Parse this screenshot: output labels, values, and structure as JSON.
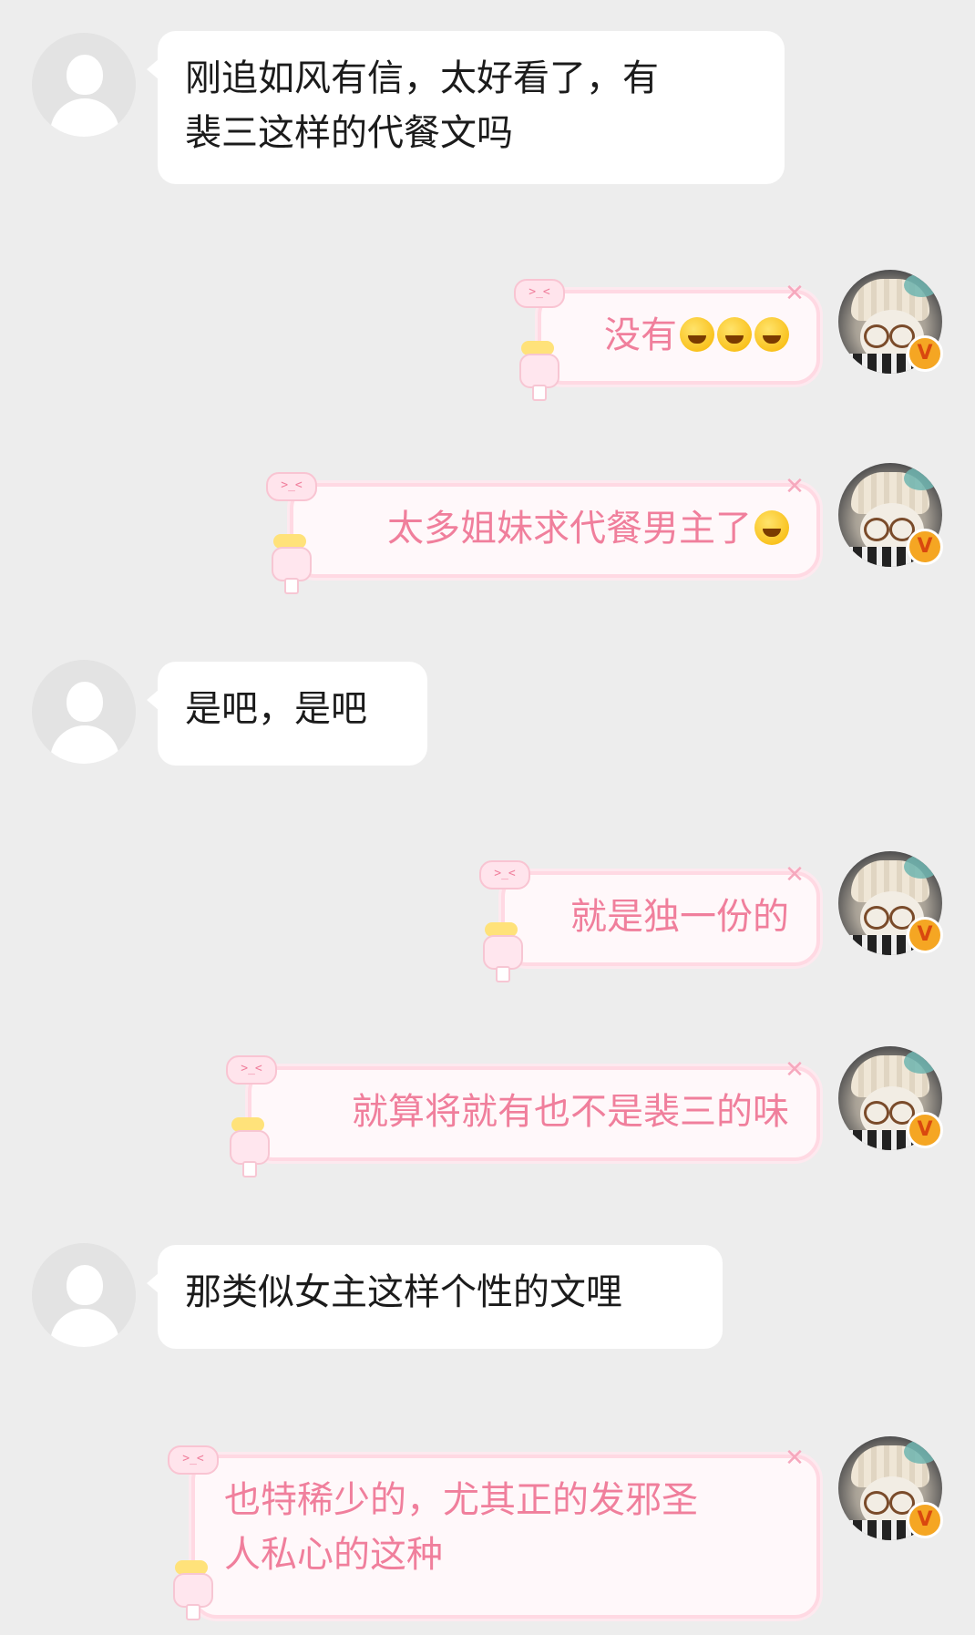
{
  "chat": {
    "messages": [
      {
        "sender": "other",
        "lines": [
          "刚追如风有信，太好看了，有",
          "裴三这样的代餐文吗"
        ]
      },
      {
        "sender": "me",
        "text": "没有",
        "emoji": [
          "crying-laughing-emoji",
          "crying-laughing-emoji",
          "crying-laughing-emoji"
        ],
        "verified": "V"
      },
      {
        "sender": "me",
        "text": "太多姐妹求代餐男主了",
        "emoji": [
          "laughing-tears-emoji"
        ],
        "verified": "V"
      },
      {
        "sender": "other",
        "lines": [
          "是吧，是吧"
        ]
      },
      {
        "sender": "me",
        "text": "就是独一份的",
        "emoji": [],
        "verified": "V"
      },
      {
        "sender": "me",
        "text": "就算将就有也不是裴三的味",
        "emoji": [],
        "verified": "V"
      },
      {
        "sender": "other",
        "lines": [
          "那类似女主这样个性的文哩"
        ]
      },
      {
        "sender": "me",
        "lines": [
          "也特稀少的，尤其正的发邪圣",
          "人私心的这种"
        ],
        "emoji": [],
        "verified": "V"
      }
    ],
    "bubble_deco": {
      "tag_text": ">_<",
      "close_glyph": "✕"
    },
    "colors": {
      "background": "#ededed",
      "other_bubble": "#ffffff",
      "my_bubble_text": "#f07f9c",
      "my_bubble_border": "#ffd9e3",
      "verified_badge": "#f5a623"
    }
  }
}
